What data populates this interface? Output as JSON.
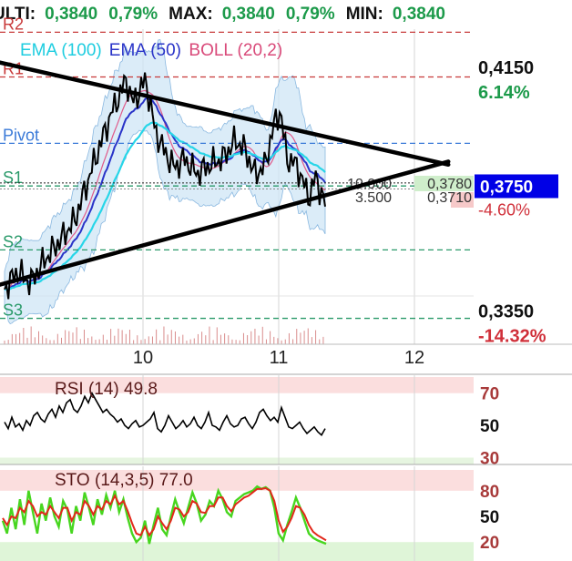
{
  "header": {
    "last_label": "ULTI:",
    "last_value": "0,3840",
    "last_pct": "0,79%",
    "max_label": "MAX:",
    "max_value": "0,3840",
    "max_pct": "0,79%",
    "min_label": "MIN:",
    "min_value": "0,3840"
  },
  "colors": {
    "up_green": "#1c9a4a",
    "down_red": "#d0303a",
    "price_tag_bg": "#0000e6",
    "ema100": "#27d6e8",
    "ema50": "#2a34c8",
    "boll": "#e05a8a",
    "band_fill": "#cfe6f5",
    "sto_k": "#47d61f",
    "sto_d": "#e2281b"
  },
  "main_chart": {
    "price_axis": {
      "labels": [
        {
          "value": 0.415,
          "text": "0,4150",
          "pct": "6.14%",
          "pct_color": "green"
        },
        {
          "value": 0.335,
          "text": "0,3350",
          "pct": "-14.32%",
          "pct_color": "red"
        }
      ],
      "current_price": "0,3750",
      "current_pct": "-4.60%",
      "y_range": [
        0.325,
        0.4285
      ]
    },
    "x_ticks": [
      "10",
      "11",
      "12"
    ],
    "indicators": [
      {
        "name": "EMA (100)",
        "color": "cyan"
      },
      {
        "name": "EMA (50)",
        "color": "blue"
      },
      {
        "name": "BOLL (20,2)",
        "color": "pink"
      }
    ],
    "pivot_levels": [
      {
        "name": "R2",
        "value": 0.4275,
        "color": "#c83a3a"
      },
      {
        "name": "R1",
        "value": 0.4128,
        "color": "#c83a3a"
      },
      {
        "name": "Pivot",
        "value": 0.391,
        "color": "#3a7ad8"
      },
      {
        "name": "S1",
        "value": 0.377,
        "color": "#2a9a6a"
      },
      {
        "name": "S2",
        "value": 0.356,
        "color": "#2a9a6a"
      },
      {
        "name": "S3",
        "value": 0.3335,
        "color": "#2a9a6a"
      }
    ],
    "order_book": [
      {
        "size": "10.000",
        "price": "0,3780"
      },
      {
        "size": "3.500",
        "price": "0,3710"
      }
    ],
    "trend_lines": [
      {
        "from": [
          8.85,
          0.4185
        ],
        "to": [
          12.25,
          0.384
        ]
      },
      {
        "from": [
          8.0,
          0.333
        ],
        "to": [
          12.25,
          0.385
        ]
      }
    ]
  },
  "rsi_panel": {
    "title": "RSI (14) 49.8",
    "levels": [
      "70",
      "50",
      "30"
    ],
    "series": [
      52,
      48,
      55,
      49,
      51,
      47,
      53,
      50,
      56,
      58,
      54,
      52,
      57,
      60,
      55,
      62,
      58,
      64,
      66,
      60,
      58,
      62,
      68,
      64,
      70,
      66,
      62,
      58,
      60,
      57,
      55,
      52,
      54,
      50,
      48,
      51,
      53,
      49,
      50,
      52,
      54,
      58,
      48,
      46,
      50,
      56,
      52,
      48,
      50,
      53,
      49,
      51,
      55,
      50,
      48,
      52,
      58,
      50,
      49,
      47,
      52,
      56,
      51,
      49,
      50,
      54,
      55,
      51,
      48,
      52,
      58,
      60,
      56,
      53,
      55,
      52,
      61,
      55,
      49,
      48,
      50,
      52,
      48,
      45,
      47,
      49,
      46,
      44,
      48
    ]
  },
  "sto_panel": {
    "title": "STO (14,3,5) 77.0",
    "levels": [
      "80",
      "50",
      "20"
    ],
    "k_series": [
      45,
      30,
      60,
      35,
      70,
      40,
      80,
      55,
      30,
      65,
      45,
      72,
      50,
      38,
      68,
      58,
      30,
      62,
      45,
      78,
      60,
      40,
      70,
      52,
      75,
      60,
      80,
      55,
      70,
      48,
      30,
      20,
      25,
      45,
      18,
      40,
      60,
      35,
      28,
      50,
      70,
      55,
      42,
      60,
      78,
      65,
      45,
      52,
      68,
      62,
      80,
      70,
      55,
      50,
      68,
      72,
      76,
      78,
      80,
      85,
      82,
      84,
      80,
      60,
      30,
      22,
      40,
      55,
      72,
      60,
      45,
      30,
      25,
      22,
      20,
      18
    ],
    "d_series": [
      48,
      40,
      50,
      48,
      60,
      55,
      68,
      62,
      50,
      55,
      52,
      62,
      55,
      48,
      60,
      60,
      45,
      55,
      52,
      68,
      62,
      52,
      62,
      58,
      68,
      64,
      74,
      64,
      68,
      56,
      42,
      30,
      28,
      38,
      28,
      35,
      50,
      42,
      35,
      45,
      60,
      58,
      50,
      55,
      68,
      65,
      55,
      54,
      62,
      62,
      72,
      72,
      62,
      56,
      64,
      68,
      72,
      74,
      78,
      82,
      82,
      83,
      80,
      68,
      45,
      32,
      38,
      48,
      62,
      60,
      52,
      40,
      32,
      28,
      25,
      22
    ]
  }
}
